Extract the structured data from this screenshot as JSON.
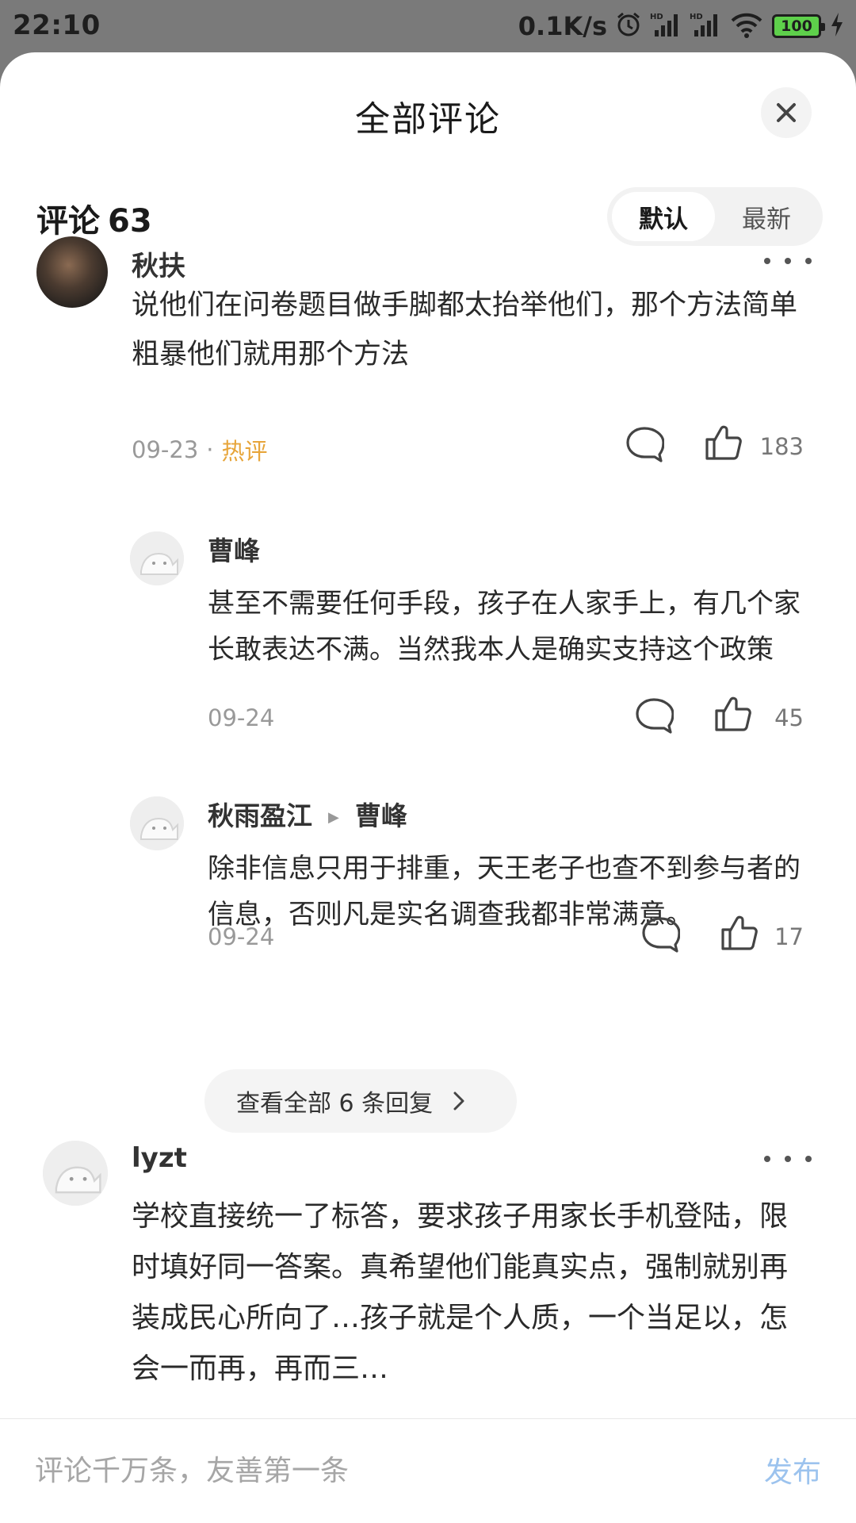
{
  "status_bar": {
    "time": "22:10",
    "net_speed": "0.1K/s",
    "battery": "100",
    "icons": [
      "alarm-icon",
      "signal-hd-icon",
      "signal-hd-icon",
      "wifi-icon",
      "battery-icon",
      "charging-icon"
    ]
  },
  "sheet": {
    "title": "全部评论",
    "close_icon": "close-icon"
  },
  "comments_header": {
    "label": "评论",
    "count": "63"
  },
  "sort": {
    "options": [
      "默认",
      "最新"
    ],
    "selected": "默认"
  },
  "comments": [
    {
      "author": "秋扶",
      "text": "说他们在问卷题目做手脚都太抬举他们，那个方法简单粗暴他们就用那个方法",
      "date": "09-23",
      "badge": "热评",
      "likes": "183"
    },
    {
      "author": "lyzt",
      "text": "学校直接统一了标答，要求孩子用家长手机登陆，限时填好同一答案。真希望他们能真实点，强制就别再装成民心所向了…孩子就是个人质，一个当足以，怎会一而再，再而三…"
    }
  ],
  "replies": [
    {
      "author": "曹峰",
      "text": "甚至不需要任何手段，孩子在人家手上，有几个家长敢表达不满。当然我本人是确实支持这个政策",
      "date": "09-24",
      "likes": "45"
    },
    {
      "author": "秋雨盈江",
      "reply_to": "曹峰",
      "text": "除非信息只用于排重，天王老子也查不到参与者的信息，否则凡是实名调查我都非常满意。",
      "date": "09-24",
      "likes": "17"
    }
  ],
  "view_all_replies": "查看全部 6 条回复",
  "input": {
    "placeholder": "评论千万条，友善第一条",
    "value": "",
    "publish_label": "发布"
  }
}
